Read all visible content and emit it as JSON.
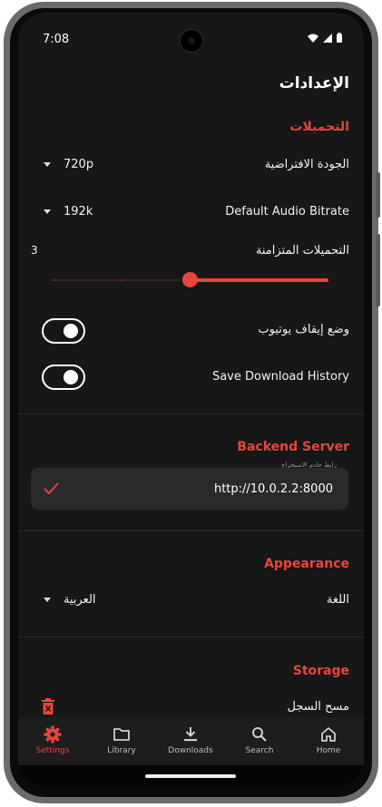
{
  "status_bar": {
    "time": "7:08"
  },
  "header": {
    "title": "الإعدادات"
  },
  "downloads_section": {
    "title": "التحميلات",
    "default_quality": {
      "label": "الجودة الافتراضية",
      "value": "720p"
    },
    "audio_bitrate": {
      "label": "Default Audio Bitrate",
      "value": "192k"
    },
    "concurrent": {
      "label": "التحميلات المتزامنة",
      "value": "3",
      "slider_fraction": 0.5
    },
    "youtube_pause": {
      "label": "وضع إيقاف يوتيوب",
      "on": true
    },
    "save_history": {
      "label": "Save Download History",
      "on": true
    }
  },
  "backend_section": {
    "title": "Backend Server",
    "field_label": "رابط خادم الاستخراج",
    "url": "http://10.0.2.2:8000"
  },
  "appearance_section": {
    "title": "Appearance",
    "language": {
      "label": "اللغة",
      "value": "العربية"
    }
  },
  "storage_section": {
    "title": "Storage",
    "clear_history": {
      "label": "مسح السجل"
    }
  },
  "bottom_nav": [
    {
      "label": "Settings",
      "icon": "gear-icon",
      "active": true
    },
    {
      "label": "Library",
      "icon": "folder-icon",
      "active": false
    },
    {
      "label": "Downloads",
      "icon": "download-icon",
      "active": false
    },
    {
      "label": "Search",
      "icon": "search-icon",
      "active": false
    },
    {
      "label": "Home",
      "icon": "home-icon",
      "active": false
    }
  ],
  "colors": {
    "accent": "#e8453c",
    "background": "#171717"
  }
}
